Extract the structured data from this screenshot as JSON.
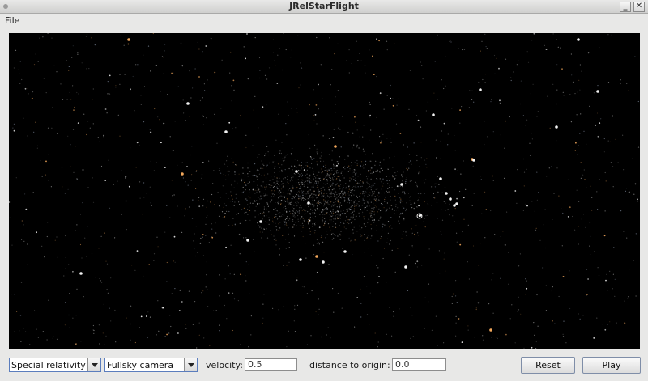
{
  "window": {
    "title": "JRelStarFlight",
    "minimize_label": "_",
    "close_label": "✕"
  },
  "menubar": {
    "items": [
      {
        "label": "File"
      }
    ]
  },
  "controls": {
    "theory": {
      "selected": "Special relativity"
    },
    "camera": {
      "selected": "Fullsky camera"
    },
    "velocity": {
      "label": "velocity:",
      "value": "0.5"
    },
    "distance": {
      "label": "distance to origin:",
      "value": "0.0"
    },
    "reset_label": "Reset",
    "play_label": "Play"
  },
  "colors": {
    "sky_background": "#000000",
    "star_white": "#ffffff",
    "star_orange": "#ffb060",
    "star_blue": "#cfe0ff"
  }
}
